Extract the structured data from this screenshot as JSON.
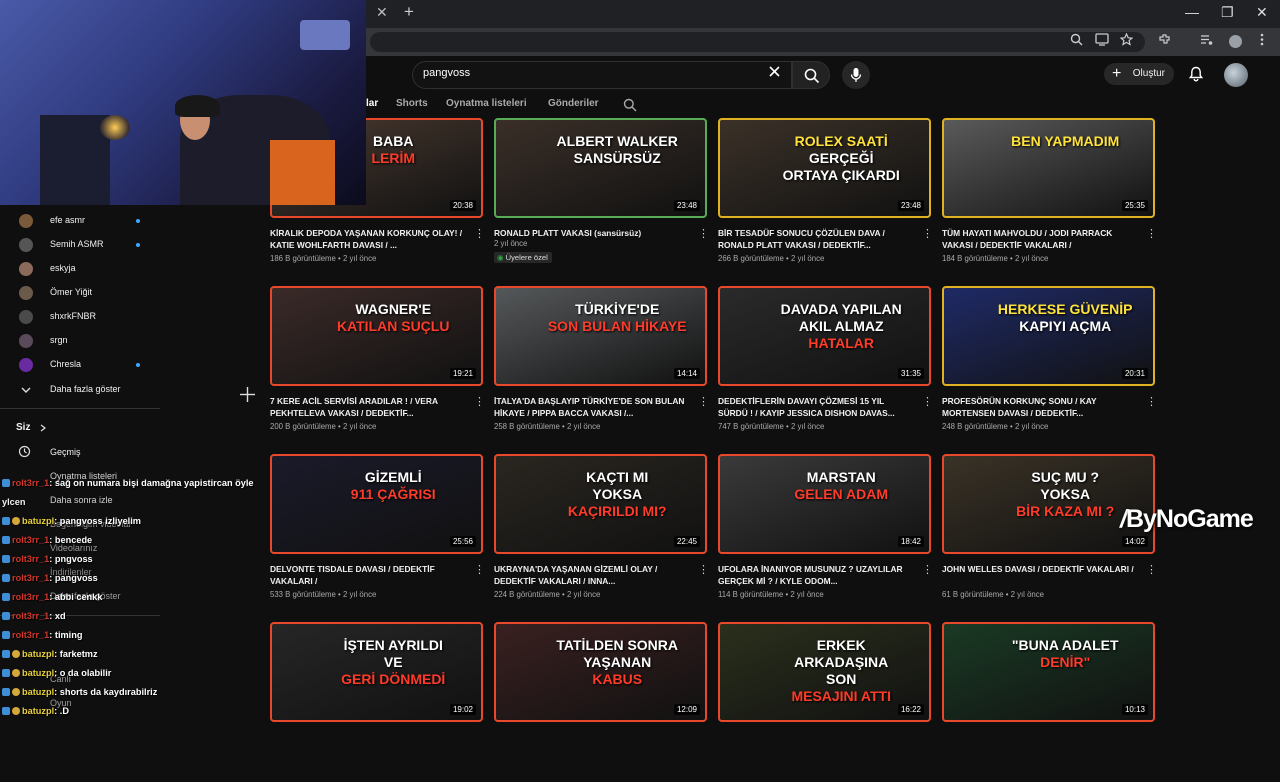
{
  "browser": {
    "window_controls": [
      "—",
      "❐",
      "✕"
    ],
    "tab_close": "✕",
    "new_tab": "+"
  },
  "header": {
    "search_query": "pangvoss",
    "create_label": "Oluştur"
  },
  "channel_tabs": [
    "lar",
    "Shorts",
    "Oynatma listeleri",
    "Gönderiler"
  ],
  "sidebar": {
    "subscriptions": [
      {
        "name": "efe asmr",
        "live": true,
        "color": "#7a5a3a"
      },
      {
        "name": "Semih ASMR",
        "live": true,
        "color": "#555"
      },
      {
        "name": "eskyja",
        "live": false,
        "color": "#8a6a5a"
      },
      {
        "name": "Ömer Yiğit",
        "live": false,
        "color": "#6a5a4a"
      },
      {
        "name": "shxrkFNBR",
        "live": false,
        "color": "#4a4a4a"
      },
      {
        "name": "srgn",
        "live": false,
        "color": "#5a4a5a"
      },
      {
        "name": "Chresla",
        "live": true,
        "color": "#6a2aa0"
      }
    ],
    "show_more": "Daha fazla göster",
    "you_label": "Siz",
    "you_items": [
      "Geçmiş",
      "Oynatma listeleri",
      "Daha sonra izle",
      "Beğendiğim videolar",
      "Videolarınız",
      "İndirilenler",
      "Daha fazla göster"
    ],
    "bottom_items": [
      "Canlı",
      "Oyun"
    ]
  },
  "videos": [
    {
      "thumb_lines": [
        "BABA",
        "LERİM"
      ],
      "duration": "20:38",
      "title": "KİRALIK DEPODA YAŞANAN KORKUNÇ OLAY! / KATIE WOHLFARTH DAVASI / ...",
      "meta": "186 B görüntüleme • 2 yıl önce",
      "accent": "red",
      "bg": "#4a3a30"
    },
    {
      "thumb_lines": [
        "ALBERT WALKER",
        "SANSÜRSÜZ"
      ],
      "duration": "23:48",
      "title": "RONALD PLATT VAKASI (sansürsüz)",
      "meta": "2 yıl önce",
      "badge": "Üyelere özel",
      "accent": "green",
      "bg": "#3a2f28"
    },
    {
      "thumb_lines": [
        "ROLEX SAATİ",
        "GERÇEĞİ",
        "ORTAYA ÇIKARDI"
      ],
      "duration": "23:48",
      "title": "BİR TESADÜF SONUCU ÇÖZÜLEN DAVA / RONALD PLATT VAKASI / DEDEKTİF...",
      "meta": "266 B görüntüleme • 2 yıl önce",
      "accent": "yellow",
      "bg": "#3b3128"
    },
    {
      "thumb_lines": [
        "BEN YAPMADIM"
      ],
      "duration": "25:35",
      "title": "TÜM HAYATI MAHVOLDU / JODI PARRACK VAKASI / DEDEKTİF VAKALARI /",
      "meta": "184 B görüntüleme • 2 yıl önce",
      "accent": "yellow",
      "bg": "#5a5a5a"
    },
    {
      "thumb_lines": [
        "WAGNER'E",
        "KATILAN SUÇLU"
      ],
      "duration": "19:21",
      "title": "7 KERE ACİL SERVİSİ ARADILAR ! / VERA PEKHTELEVA VAKASI / DEDEKTİF...",
      "meta": "200 B görüntüleme • 2 yıl önce",
      "accent": "red",
      "bg": "#3a2a28"
    },
    {
      "thumb_lines": [
        "TÜRKİYE'DE",
        "SON BULAN HİKAYE"
      ],
      "duration": "14:14",
      "title": "İTALYA'DA BAŞLAYIP TÜRKİYE'DE SON BULAN HİKAYE / PIPPA BACCA VAKASI /...",
      "meta": "258 B görüntüleme • 2 yıl önce",
      "accent": "red",
      "bg": "#55585a"
    },
    {
      "thumb_lines": [
        "DAVADA YAPILAN",
        "AKIL ALMAZ",
        "HATALAR"
      ],
      "duration": "31:35",
      "title": "DEDEKTİFLERİN DAVAYI ÇÖZMESİ 15 YIL SÜRDÜ ! / KAYIP JESSICA DISHON DAVAS...",
      "meta": "747 B görüntüleme • 2 yıl önce",
      "accent": "red",
      "bg": "#2a2a2a"
    },
    {
      "thumb_lines": [
        "HERKESE GÜVENİP",
        "KAPIYI AÇMA"
      ],
      "duration": "20:31",
      "title": "PROFESÖRÜN KORKUNÇ SONU / KAY MORTENSEN DAVASI / DEDEKTİF...",
      "meta": "248 B görüntüleme • 2 yıl önce",
      "accent": "yellow",
      "bg": "#1f2a66"
    },
    {
      "thumb_lines": [
        "GİZEMLİ",
        "911 ÇAĞRISI"
      ],
      "duration": "25:56",
      "title": "DELVONTE TISDALE DAVASI / DEDEKTİF VAKALARI /",
      "meta": "533 B görüntüleme • 2 yıl önce",
      "accent": "red",
      "bg": "#1a1a2a"
    },
    {
      "thumb_lines": [
        "KAÇTI MI",
        "YOKSA",
        "KAÇIRILDI MI?"
      ],
      "duration": "22:45",
      "title": "UKRAYNA'DA YAŞANAN GİZEMLİ OLAY / DEDEKTİF VAKALARI / INNA...",
      "meta": "224 B görüntüleme • 2 yıl önce",
      "accent": "red",
      "bg": "#2a2620"
    },
    {
      "thumb_lines": [
        "MARSTAN",
        "GELEN ADAM"
      ],
      "duration": "18:42",
      "title": "UFOLARA İNANIYOR MUSUNUZ ? UZAYLILAR GERÇEK Mİ ? / KYLE ODOM...",
      "meta": "114 B görüntüleme • 2 yıl önce",
      "accent": "red",
      "bg": "#3a3a3a"
    },
    {
      "thumb_lines": [
        "SUÇ MU ?",
        "YOKSA",
        "BİR KAZA MI ?"
      ],
      "duration": "14:02",
      "title": "JOHN WELLES DAVASI / DEDEKTİF VAKALARI /",
      "meta": "61 B görüntüleme • 2 yıl önce",
      "accent": "red",
      "bg": "#3a3226"
    },
    {
      "thumb_lines": [
        "İŞTEN AYRILDI",
        "VE",
        "GERİ DÖNMEDİ"
      ],
      "duration": "19:02",
      "title": "",
      "meta": "",
      "accent": "red",
      "bg": "#262626"
    },
    {
      "thumb_lines": [
        "TATİLDEN SONRA",
        "YAŞANAN",
        "KABUS"
      ],
      "duration": "12:09",
      "title": "",
      "meta": "",
      "accent": "red",
      "bg": "#3a2020"
    },
    {
      "thumb_lines": [
        "ERKEK",
        "ARKADAŞINA",
        "SON",
        "MESAJINI ATTI"
      ],
      "duration": "16:22",
      "title": "",
      "meta": "",
      "accent": "red",
      "bg": "#2a301c"
    },
    {
      "thumb_lines": [
        "\"BUNA ADALET",
        "DENİR\""
      ],
      "duration": "10:13",
      "title": "",
      "meta": "",
      "accent": "red",
      "bg": "#1a3a24"
    }
  ],
  "chat": [
    {
      "user": "rolt3rr_1",
      "user_color": "red",
      "msg": ": sağ on numara bişi damağna yapistircan öyle"
    },
    {
      "user": "ylcen",
      "user_color": "white",
      "msg": ""
    },
    {
      "user": "batuzpl",
      "user_color": "yellow",
      "msg": ": pangvoss izliyelim"
    },
    {
      "user": "rolt3rr_1",
      "user_color": "red",
      "msg": ": bencede"
    },
    {
      "user": "rolt3rr_1",
      "user_color": "red",
      "msg": ": pngvoss"
    },
    {
      "user": "rolt3rr_1",
      "user_color": "red",
      "msg": ": pangvoss"
    },
    {
      "user": "rolt3rr_1",
      "user_color": "red",
      "msg": ": abbi cenkk"
    },
    {
      "user": "rolt3rr_1",
      "user_color": "red",
      "msg": ": xd"
    },
    {
      "user": "rolt3rr_1",
      "user_color": "red",
      "msg": ": timing"
    },
    {
      "user": "batuzpl",
      "user_color": "yellow",
      "msg": ": farketmz"
    },
    {
      "user": "batuzpl",
      "user_color": "yellow",
      "msg": ": o da olabilir"
    },
    {
      "user": "batuzpl",
      "user_color": "yellow",
      "msg": ": shorts da kaydırabilriz"
    },
    {
      "user": "batuzpl",
      "user_color": "yellow",
      "msg": ": .D"
    }
  ],
  "watermark": {
    "prefix": "By",
    "brand": "NoGame"
  }
}
